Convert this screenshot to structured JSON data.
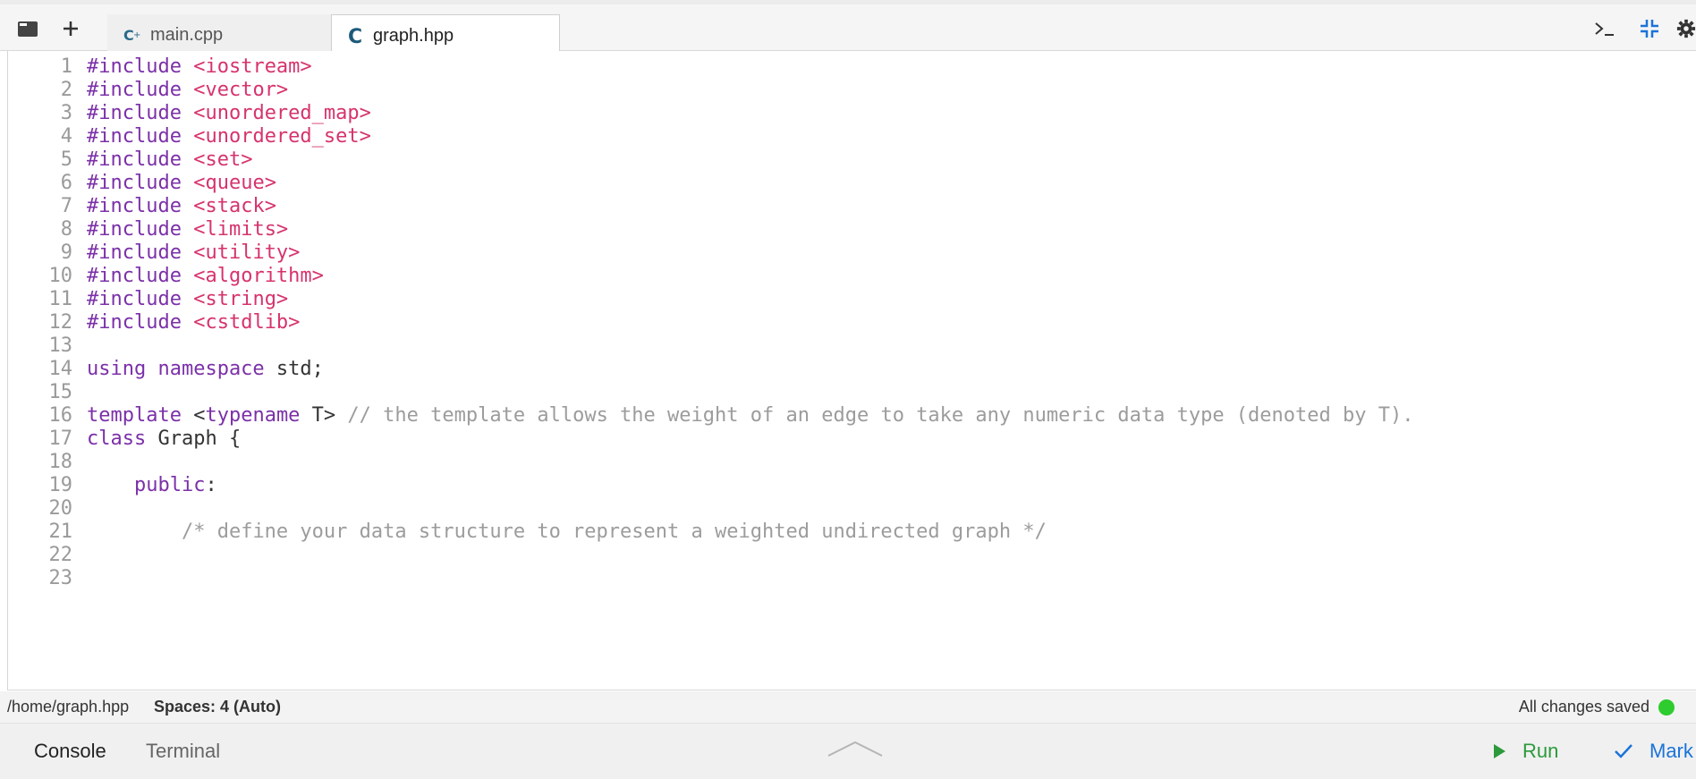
{
  "tabs": [
    {
      "label": "main.cpp",
      "icon": "cpp-file-icon",
      "active": false
    },
    {
      "label": "graph.hpp",
      "icon": "c-file-icon",
      "active": true
    }
  ],
  "editor": {
    "lines": [
      {
        "num": "1",
        "parts": [
          {
            "t": "#include ",
            "c": "kw"
          },
          {
            "t": "<iostream>",
            "c": "str"
          }
        ]
      },
      {
        "num": "2",
        "parts": [
          {
            "t": "#include ",
            "c": "kw"
          },
          {
            "t": "<vector>",
            "c": "str"
          }
        ]
      },
      {
        "num": "3",
        "parts": [
          {
            "t": "#include ",
            "c": "kw"
          },
          {
            "t": "<unordered_map>",
            "c": "str"
          }
        ]
      },
      {
        "num": "4",
        "parts": [
          {
            "t": "#include ",
            "c": "kw"
          },
          {
            "t": "<unordered_set>",
            "c": "str"
          }
        ]
      },
      {
        "num": "5",
        "parts": [
          {
            "t": "#include ",
            "c": "kw"
          },
          {
            "t": "<set>",
            "c": "str"
          }
        ]
      },
      {
        "num": "6",
        "parts": [
          {
            "t": "#include ",
            "c": "kw"
          },
          {
            "t": "<queue>",
            "c": "str"
          }
        ]
      },
      {
        "num": "7",
        "parts": [
          {
            "t": "#include ",
            "c": "kw"
          },
          {
            "t": "<stack>",
            "c": "str"
          }
        ]
      },
      {
        "num": "8",
        "parts": [
          {
            "t": "#include ",
            "c": "kw"
          },
          {
            "t": "<limits>",
            "c": "str"
          }
        ]
      },
      {
        "num": "9",
        "parts": [
          {
            "t": "#include ",
            "c": "kw"
          },
          {
            "t": "<utility>",
            "c": "str"
          }
        ]
      },
      {
        "num": "10",
        "parts": [
          {
            "t": "#include ",
            "c": "kw"
          },
          {
            "t": "<algorithm>",
            "c": "str"
          }
        ]
      },
      {
        "num": "11",
        "parts": [
          {
            "t": "#include ",
            "c": "kw"
          },
          {
            "t": "<string>",
            "c": "str"
          }
        ]
      },
      {
        "num": "12",
        "parts": [
          {
            "t": "#include ",
            "c": "kw"
          },
          {
            "t": "<cstdlib>",
            "c": "str"
          }
        ]
      },
      {
        "num": "13",
        "parts": []
      },
      {
        "num": "14",
        "parts": [
          {
            "t": "using namespace",
            "c": "kw"
          },
          {
            "t": " std;",
            "c": ""
          }
        ]
      },
      {
        "num": "15",
        "parts": []
      },
      {
        "num": "16",
        "parts": [
          {
            "t": "template",
            "c": "kw"
          },
          {
            "t": " <",
            "c": ""
          },
          {
            "t": "typename",
            "c": "kw"
          },
          {
            "t": " T> ",
            "c": ""
          },
          {
            "t": "// the template allows the weight of an edge to take any numeric data type (denoted by T).",
            "c": "cmt"
          }
        ]
      },
      {
        "num": "17",
        "parts": [
          {
            "t": "class",
            "c": "kw"
          },
          {
            "t": " Graph {",
            "c": ""
          }
        ]
      },
      {
        "num": "18",
        "parts": []
      },
      {
        "num": "19",
        "parts": [
          {
            "t": "    ",
            "c": ""
          },
          {
            "t": "public",
            "c": "kw"
          },
          {
            "t": ":",
            "c": ""
          }
        ]
      },
      {
        "num": "20",
        "parts": []
      },
      {
        "num": "21",
        "parts": [
          {
            "t": "        ",
            "c": ""
          },
          {
            "t": "/* define your data structure to represent a weighted undirected graph */",
            "c": "cmt"
          }
        ]
      },
      {
        "num": "22",
        "parts": []
      },
      {
        "num": "23",
        "parts": []
      }
    ]
  },
  "status": {
    "path": "/home/graph.hpp",
    "spaces": "Spaces: 4 (Auto)",
    "saved": "All changes saved"
  },
  "bottom": {
    "console": "Console",
    "terminal": "Terminal",
    "run": "Run",
    "mark": "Mark"
  },
  "colors": {
    "keyword": "#7b30a8",
    "string": "#d6336c",
    "comment": "#9c9c9c",
    "run": "#2a9a3a",
    "mark": "#1a73d9",
    "saved_dot": "#2ecc2e"
  }
}
